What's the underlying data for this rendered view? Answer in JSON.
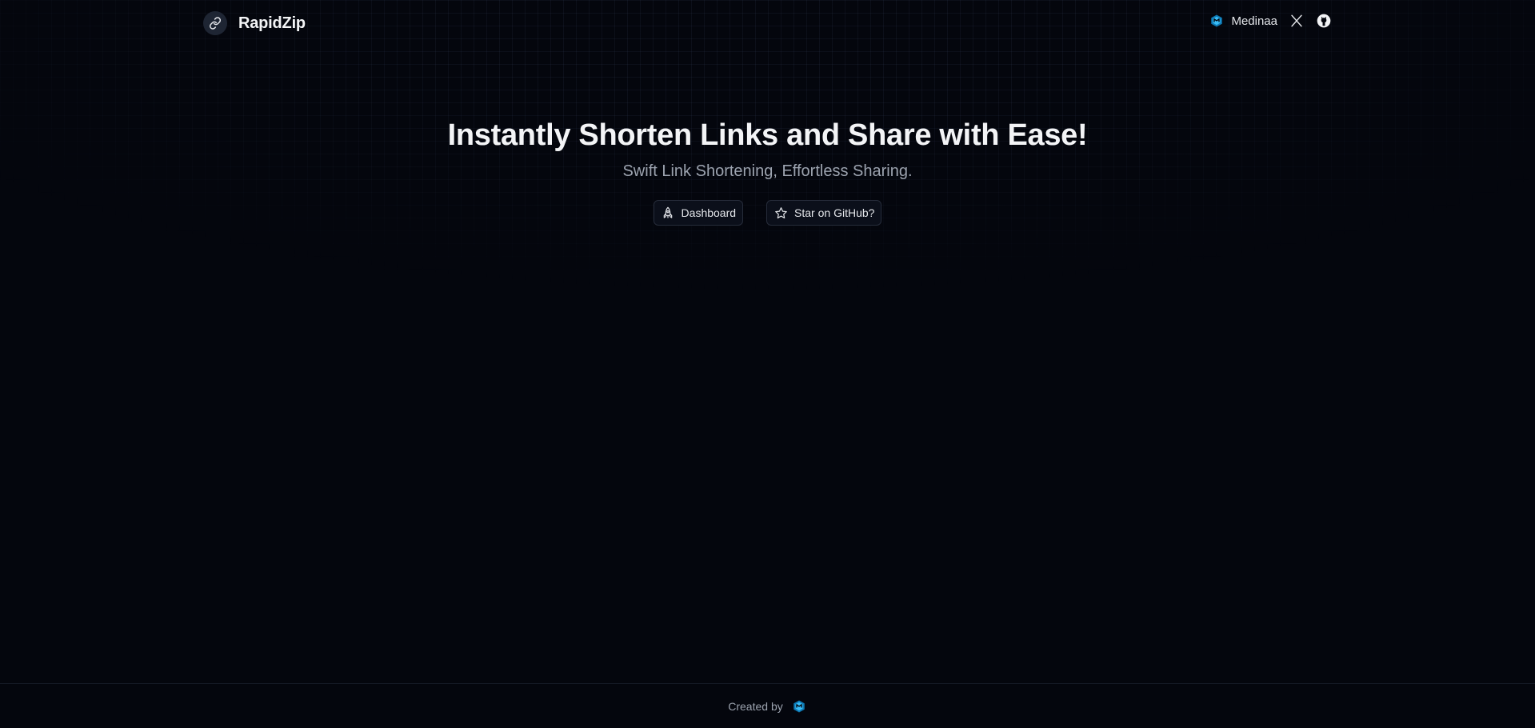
{
  "brand": {
    "name": "RapidZip",
    "logo_icon": "link-icon"
  },
  "nav": {
    "author_name": "Medinaa",
    "author_icon": "medinaa-logo-icon",
    "x_icon": "x-twitter-icon",
    "github_icon": "github-icon"
  },
  "hero": {
    "title": "Instantly Shorten Links and Share with Ease!",
    "subtitle": "Swift Link Shortening, Effortless Sharing.",
    "buttons": [
      {
        "label": "Dashboard",
        "icon": "rocket-icon"
      },
      {
        "label": "Star on GitHub?",
        "icon": "star-icon"
      }
    ]
  },
  "footer": {
    "text": "Created by",
    "icon": "medinaa-logo-icon"
  },
  "colors": {
    "background": "#04060d",
    "accent": "#38bdf8",
    "text": "#f3f4f6",
    "muted": "#9ca3af"
  }
}
